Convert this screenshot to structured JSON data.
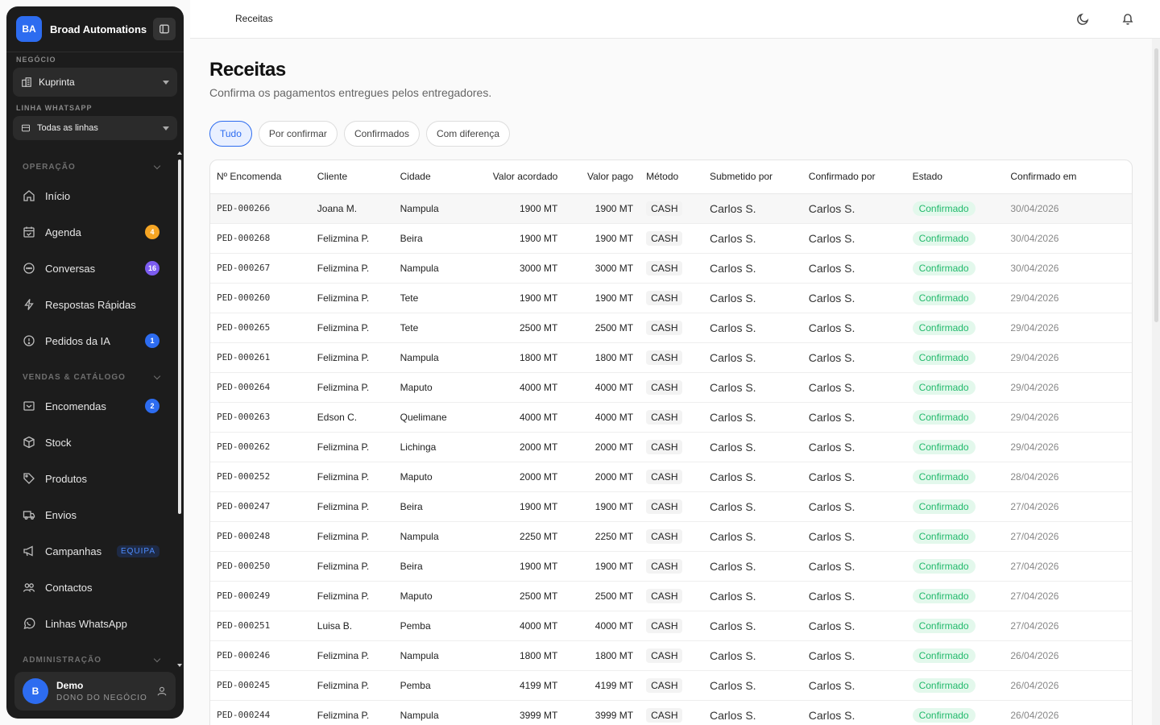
{
  "brand": {
    "initials": "BA",
    "name": "Broad Automations"
  },
  "business": {
    "section_label": "NEGÓCIO",
    "selected": "Kuprinta"
  },
  "whatsapp_line": {
    "section_label": "LINHA WHATSAPP",
    "selected": "Todas as linhas"
  },
  "nav": {
    "groups": {
      "operation": "OPERAÇÃO",
      "sales": "VENDAS & CATÁLOGO",
      "admin": "ADMINISTRAÇÃO"
    },
    "items": {
      "inicio": {
        "label": "Início"
      },
      "agenda": {
        "label": "Agenda",
        "badge": "4"
      },
      "conversas": {
        "label": "Conversas",
        "badge": "16"
      },
      "respostas": {
        "label": "Respostas Rápidas"
      },
      "pedidos_ia": {
        "label": "Pedidos da IA",
        "badge": "1"
      },
      "encomendas": {
        "label": "Encomendas",
        "badge": "2"
      },
      "stock": {
        "label": "Stock"
      },
      "produtos": {
        "label": "Produtos"
      },
      "envios": {
        "label": "Envios"
      },
      "campanhas": {
        "label": "Campanhas",
        "tag": "EQUIPA"
      },
      "contactos": {
        "label": "Contactos"
      },
      "linhas": {
        "label": "Linhas WhatsApp"
      }
    }
  },
  "user": {
    "initial": "B",
    "name": "Demo",
    "role": "DONO DO NEGÓCIO"
  },
  "topbar": {
    "breadcrumb": "Receitas"
  },
  "page": {
    "title": "Receitas",
    "subtitle": "Confirma os pagamentos entregues pelos entregadores."
  },
  "filters": [
    "Tudo",
    "Por confirmar",
    "Confirmados",
    "Com diferença"
  ],
  "table": {
    "columns": [
      "Nº Encomenda",
      "Cliente",
      "Cidade",
      "Valor acordado",
      "Valor pago",
      "Método",
      "Submetido por",
      "Confirmado por",
      "Estado",
      "Confirmado em"
    ],
    "rows": [
      [
        "PED-000266",
        "Joana M.",
        "Nampula",
        "1900 MT",
        "1900 MT",
        "CASH",
        "Carlos S.",
        "Carlos S.",
        "Confirmado",
        "30/04/2026"
      ],
      [
        "PED-000268",
        "Felizmina P.",
        "Beira",
        "1900 MT",
        "1900 MT",
        "CASH",
        "Carlos S.",
        "Carlos S.",
        "Confirmado",
        "30/04/2026"
      ],
      [
        "PED-000267",
        "Felizmina P.",
        "Nampula",
        "3000 MT",
        "3000 MT",
        "CASH",
        "Carlos S.",
        "Carlos S.",
        "Confirmado",
        "30/04/2026"
      ],
      [
        "PED-000260",
        "Felizmina P.",
        "Tete",
        "1900 MT",
        "1900 MT",
        "CASH",
        "Carlos S.",
        "Carlos S.",
        "Confirmado",
        "29/04/2026"
      ],
      [
        "PED-000265",
        "Felizmina P.",
        "Tete",
        "2500 MT",
        "2500 MT",
        "CASH",
        "Carlos S.",
        "Carlos S.",
        "Confirmado",
        "29/04/2026"
      ],
      [
        "PED-000261",
        "Felizmina P.",
        "Nampula",
        "1800 MT",
        "1800 MT",
        "CASH",
        "Carlos S.",
        "Carlos S.",
        "Confirmado",
        "29/04/2026"
      ],
      [
        "PED-000264",
        "Felizmina P.",
        "Maputo",
        "4000 MT",
        "4000 MT",
        "CASH",
        "Carlos S.",
        "Carlos S.",
        "Confirmado",
        "29/04/2026"
      ],
      [
        "PED-000263",
        "Edson C.",
        "Quelimane",
        "4000 MT",
        "4000 MT",
        "CASH",
        "Carlos S.",
        "Carlos S.",
        "Confirmado",
        "29/04/2026"
      ],
      [
        "PED-000262",
        "Felizmina P.",
        "Lichinga",
        "2000 MT",
        "2000 MT",
        "CASH",
        "Carlos S.",
        "Carlos S.",
        "Confirmado",
        "29/04/2026"
      ],
      [
        "PED-000252",
        "Felizmina P.",
        "Maputo",
        "2000 MT",
        "2000 MT",
        "CASH",
        "Carlos S.",
        "Carlos S.",
        "Confirmado",
        "28/04/2026"
      ],
      [
        "PED-000247",
        "Felizmina P.",
        "Beira",
        "1900 MT",
        "1900 MT",
        "CASH",
        "Carlos S.",
        "Carlos S.",
        "Confirmado",
        "27/04/2026"
      ],
      [
        "PED-000248",
        "Felizmina P.",
        "Nampula",
        "2250 MT",
        "2250 MT",
        "CASH",
        "Carlos S.",
        "Carlos S.",
        "Confirmado",
        "27/04/2026"
      ],
      [
        "PED-000250",
        "Felizmina P.",
        "Beira",
        "1900 MT",
        "1900 MT",
        "CASH",
        "Carlos S.",
        "Carlos S.",
        "Confirmado",
        "27/04/2026"
      ],
      [
        "PED-000249",
        "Felizmina P.",
        "Maputo",
        "2500 MT",
        "2500 MT",
        "CASH",
        "Carlos S.",
        "Carlos S.",
        "Confirmado",
        "27/04/2026"
      ],
      [
        "PED-000251",
        "Luisa B.",
        "Pemba",
        "4000 MT",
        "4000 MT",
        "CASH",
        "Carlos S.",
        "Carlos S.",
        "Confirmado",
        "27/04/2026"
      ],
      [
        "PED-000246",
        "Felizmina P.",
        "Nampula",
        "1800 MT",
        "1800 MT",
        "CASH",
        "Carlos S.",
        "Carlos S.",
        "Confirmado",
        "26/04/2026"
      ],
      [
        "PED-000245",
        "Felizmina P.",
        "Pemba",
        "4199 MT",
        "4199 MT",
        "CASH",
        "Carlos S.",
        "Carlos S.",
        "Confirmado",
        "26/04/2026"
      ],
      [
        "PED-000244",
        "Felizmina P.",
        "Nampula",
        "3999 MT",
        "3999 MT",
        "CASH",
        "Carlos S.",
        "Carlos S.",
        "Confirmado",
        "26/04/2026"
      ]
    ]
  },
  "icons": {
    "collapse": "panel-left-icon",
    "business": "building-icon",
    "line": "store-icon",
    "theme": "moon-icon",
    "notifications": "bell-icon",
    "user_menu": "user-icon"
  },
  "colors": {
    "accent": "#2d6cf0",
    "success_text": "#21b96b",
    "success_bg": "#e3f8ec",
    "sidebar_bg": "#1c1c1c"
  }
}
